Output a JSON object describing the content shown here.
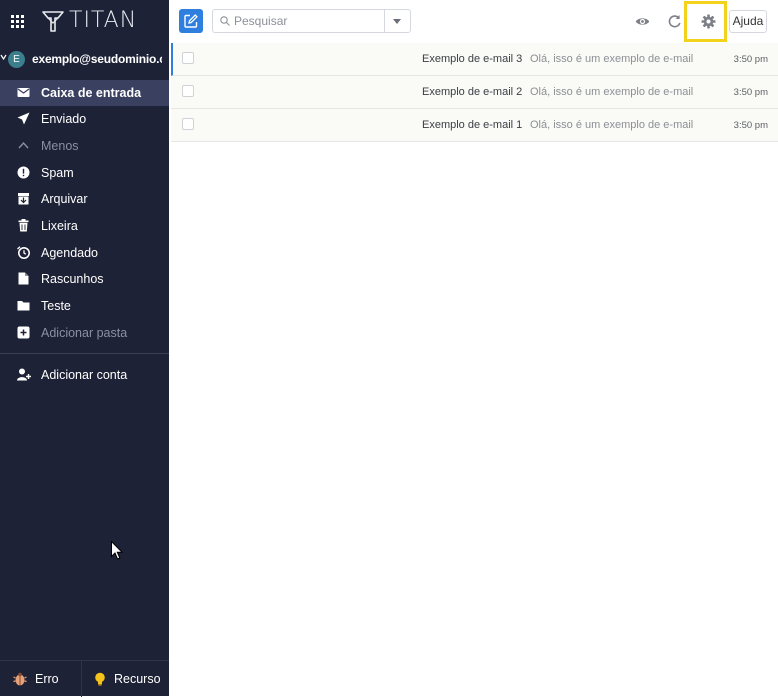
{
  "app": {
    "brand": "TITAN"
  },
  "account": {
    "initial": "E",
    "email": "exemplo@seudominio.co..."
  },
  "sidebar": {
    "folders": [
      {
        "label": "Caixa de entrada",
        "icon": "inbox-icon",
        "active": true
      },
      {
        "label": "Enviado",
        "icon": "send-icon"
      },
      {
        "label": "Menos",
        "icon": "chevron-up-icon",
        "muted": true
      },
      {
        "label": "Spam",
        "icon": "alert-icon"
      },
      {
        "label": "Arquivar",
        "icon": "archive-icon"
      },
      {
        "label": "Lixeira",
        "icon": "trash-icon"
      },
      {
        "label": "Agendado",
        "icon": "clock-icon"
      },
      {
        "label": "Rascunhos",
        "icon": "draft-icon"
      },
      {
        "label": "Teste",
        "icon": "folder-icon"
      },
      {
        "label": "Adicionar pasta",
        "icon": "add-folder-icon",
        "muted": true
      }
    ],
    "add_account": "Adicionar conta",
    "footer": {
      "bug_label": "Erro",
      "feature_label": "Recurso"
    }
  },
  "toolbar": {
    "search_placeholder": "Pesquisar",
    "help_label": "Ajuda"
  },
  "messages": [
    {
      "subject": "Exemplo de e-mail 3",
      "preview": "Olá, isso é um exemplo de e-mail",
      "time": "3:50 pm"
    },
    {
      "subject": "Exemplo de e-mail 2",
      "preview": "Olá, isso é um exemplo de e-mail",
      "time": "3:50 pm"
    },
    {
      "subject": "Exemplo de e-mail 1",
      "preview": "Olá, isso é um exemplo de e-mail",
      "time": "3:50 pm"
    }
  ],
  "colors": {
    "sidebar_bg": "#1e2236",
    "sidebar_active": "#3a4060",
    "accent": "#2f7fde",
    "highlight": "#f2d21b"
  }
}
